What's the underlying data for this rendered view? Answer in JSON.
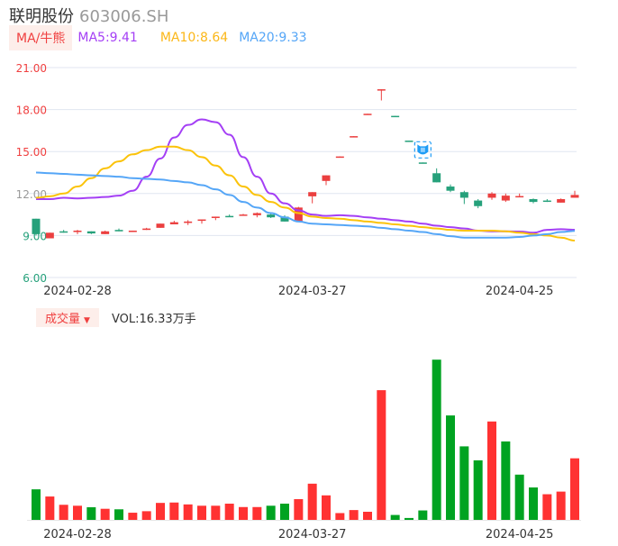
{
  "header": {
    "name": "联明股份",
    "code": "603006.SH"
  },
  "legend": {
    "tag": "MA/牛熊",
    "ma5": "MA5:9.41",
    "ma10": "MA10:8.64",
    "ma20": "MA20:9.33"
  },
  "volume_legend": {
    "tag": "成交量",
    "dropdown_icon": "triangle-down-icon",
    "value": "VOL:16.33万手"
  },
  "colors": {
    "up": "#eb3f3f",
    "down": "#26a17b",
    "vol_up": "#ff3232",
    "vol_down": "#00a321",
    "ma5": "#a43ff5",
    "ma10": "#fbc30a",
    "ma20": "#55a6f7",
    "grid": "#e0e6f1"
  },
  "chart_data": [
    {
      "type": "candlestick",
      "ylim": [
        6,
        21
      ],
      "yticks": [
        "21.00",
        "18.00",
        "15.00",
        "12.00",
        "9.00",
        "6.00"
      ],
      "ytick_values": [
        21,
        18,
        15,
        12,
        9,
        6
      ],
      "ytick_colors": [
        "#f04040",
        "#f04040",
        "#f04040",
        "#999999",
        "#26a17b",
        "#26a17b"
      ],
      "grid": true,
      "xticks": [
        {
          "index": 3,
          "label": "2024-02-28"
        },
        {
          "index": 20,
          "label": "2024-03-27"
        },
        {
          "index": 35,
          "label": "2024-04-25"
        }
      ],
      "marker": {
        "index": 28,
        "icon": "bear-shield-icon"
      },
      "ohlc": [
        [
          10.2,
          9.1,
          10.2,
          9.0
        ],
        [
          8.8,
          9.2,
          9.2,
          8.8
        ],
        [
          9.3,
          9.3,
          9.4,
          9.2
        ],
        [
          9.25,
          9.35,
          9.4,
          9.1
        ],
        [
          9.3,
          9.15,
          9.3,
          9.1
        ],
        [
          9.1,
          9.3,
          9.35,
          9.1
        ],
        [
          9.4,
          9.3,
          9.5,
          9.3
        ],
        [
          9.25,
          9.35,
          9.35,
          9.25
        ],
        [
          9.4,
          9.5,
          9.55,
          9.4
        ],
        [
          9.55,
          9.85,
          9.85,
          9.55
        ],
        [
          9.8,
          9.95,
          10.05,
          9.8
        ],
        [
          9.9,
          10.0,
          10.1,
          9.75
        ],
        [
          10.05,
          10.15,
          10.15,
          9.85
        ],
        [
          10.25,
          10.35,
          10.35,
          10.1
        ],
        [
          10.4,
          10.35,
          10.5,
          10.35
        ],
        [
          10.45,
          10.5,
          10.55,
          10.45
        ],
        [
          10.45,
          10.6,
          10.65,
          10.3
        ],
        [
          10.5,
          10.3,
          10.55,
          10.25
        ],
        [
          10.35,
          10.0,
          10.45,
          10.0
        ],
        [
          10.0,
          11.0,
          11.05,
          10.0
        ],
        [
          11.8,
          12.1,
          12.1,
          11.3
        ],
        [
          12.9,
          13.3,
          13.3,
          12.6
        ],
        [
          14.6,
          14.65,
          14.65,
          14.6
        ],
        [
          16.05,
          16.1,
          16.1,
          16.05
        ],
        [
          17.65,
          17.7,
          17.7,
          17.65
        ],
        [
          19.45,
          19.45,
          19.45,
          18.65
        ],
        [
          17.55,
          17.5,
          17.55,
          17.5
        ],
        [
          15.78,
          15.73,
          15.78,
          15.73
        ],
        [
          14.22,
          14.17,
          14.22,
          14.17
        ],
        [
          13.45,
          12.8,
          13.8,
          12.8
        ],
        [
          12.5,
          12.2,
          12.65,
          12.1
        ],
        [
          12.1,
          11.7,
          12.2,
          11.25
        ],
        [
          11.5,
          11.1,
          11.6,
          10.95
        ],
        [
          11.7,
          12.0,
          12.1,
          11.55
        ],
        [
          11.5,
          11.85,
          12.0,
          11.4
        ],
        [
          11.75,
          11.82,
          12.0,
          11.75
        ],
        [
          11.6,
          11.4,
          11.65,
          11.3
        ],
        [
          11.5,
          11.45,
          11.6,
          11.4
        ],
        [
          11.35,
          11.6,
          11.65,
          11.35
        ],
        [
          11.7,
          11.9,
          12.2,
          11.7
        ]
      ],
      "series": [
        {
          "name": "MA5",
          "values": [
            11.6,
            11.6,
            11.7,
            11.65,
            11.7,
            11.75,
            11.85,
            12.2,
            13.2,
            14.5,
            16.0,
            16.9,
            17.3,
            17.1,
            16.2,
            14.6,
            13.2,
            12.0,
            11.3,
            10.8,
            10.5,
            10.4,
            10.45,
            10.4,
            10.3,
            10.2,
            10.1,
            10.0,
            9.85,
            9.7,
            9.6,
            9.5,
            9.35,
            9.3,
            9.3,
            9.28,
            9.2,
            9.4,
            9.45,
            9.41
          ]
        },
        {
          "name": "MA10",
          "values": [
            11.7,
            11.8,
            12.0,
            12.5,
            13.1,
            13.8,
            14.3,
            14.8,
            15.1,
            15.35,
            15.35,
            15.1,
            14.6,
            14.0,
            13.3,
            12.5,
            11.9,
            11.4,
            11.0,
            10.6,
            10.35,
            10.25,
            10.2,
            10.1,
            10.0,
            9.9,
            9.8,
            9.7,
            9.6,
            9.5,
            9.4,
            9.35,
            9.35,
            9.35,
            9.3,
            9.2,
            9.1,
            9.0,
            8.85,
            8.64
          ]
        },
        {
          "name": "MA20",
          "values": [
            13.5,
            13.45,
            13.4,
            13.35,
            13.3,
            13.25,
            13.2,
            13.1,
            13.05,
            13.0,
            12.9,
            12.8,
            12.6,
            12.3,
            11.9,
            11.4,
            11.0,
            10.6,
            10.3,
            10.0,
            9.85,
            9.8,
            9.75,
            9.7,
            9.65,
            9.55,
            9.45,
            9.35,
            9.25,
            9.1,
            8.95,
            8.85,
            8.85,
            8.85,
            8.85,
            8.9,
            9.0,
            9.1,
            9.25,
            9.33
          ]
        }
      ]
    },
    {
      "type": "bar",
      "ylabel": "成交量",
      "unit": "万手",
      "ylim": [
        0,
        43.5
      ],
      "xticks": [
        {
          "index": 3,
          "label": "2024-02-28"
        },
        {
          "index": 20,
          "label": "2024-03-27"
        },
        {
          "index": 35,
          "label": "2024-04-25"
        }
      ],
      "values": [
        8.1,
        6.2,
        4.0,
        3.75,
        3.35,
        2.94,
        2.8,
        1.9,
        2.3,
        4.5,
        4.6,
        4.1,
        3.75,
        3.75,
        4.3,
        3.4,
        3.4,
        3.75,
        4.3,
        5.5,
        9.6,
        6.5,
        1.8,
        2.6,
        2.15,
        34.4,
        1.3,
        0.5,
        2.5,
        42.5,
        27.7,
        19.5,
        15.8,
        26.1,
        20.8,
        12.0,
        8.6,
        6.8,
        7.5,
        16.33
      ],
      "directions": [
        "d",
        "u",
        "u",
        "u",
        "d",
        "u",
        "d",
        "u",
        "u",
        "u",
        "u",
        "u",
        "u",
        "u",
        "u",
        "u",
        "u",
        "d",
        "d",
        "u",
        "u",
        "u",
        "u",
        "u",
        "u",
        "u",
        "d",
        "d",
        "d",
        "d",
        "d",
        "d",
        "d",
        "u",
        "d",
        "d",
        "d",
        "u",
        "u",
        "u"
      ]
    }
  ]
}
